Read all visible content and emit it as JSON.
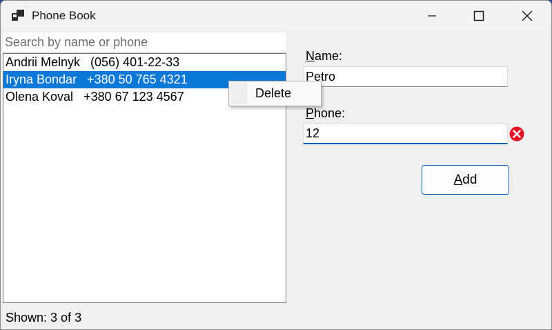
{
  "window": {
    "title": "Phone Book"
  },
  "search": {
    "placeholder": "Search by name or phone",
    "value": ""
  },
  "contacts": [
    {
      "text": "Andrii Melnyk   (056) 401-22-33",
      "selected": false
    },
    {
      "text": "Iryna Bondar   +380 50 765 4321",
      "selected": true
    },
    {
      "text": "Olena Koval   +380 67 123 4567",
      "selected": false
    }
  ],
  "status": {
    "text": "Shown: 3 of 3"
  },
  "form": {
    "name_label_key": "N",
    "name_label_rest": "ame:",
    "name_value": "Petro",
    "phone_label_key": "P",
    "phone_label_rest": "hone:",
    "phone_value": "12",
    "add_label_key": "A",
    "add_label_rest": "dd"
  },
  "context_menu": {
    "delete_label": "Delete"
  },
  "colors": {
    "selection": "#0a78d7",
    "accent": "#0a64b4",
    "error": "#e81123"
  },
  "icons": {
    "app": "phone-book-icon",
    "minimize": "minimize-icon",
    "maximize": "maximize-icon",
    "close": "close-icon",
    "error": "error-icon"
  }
}
